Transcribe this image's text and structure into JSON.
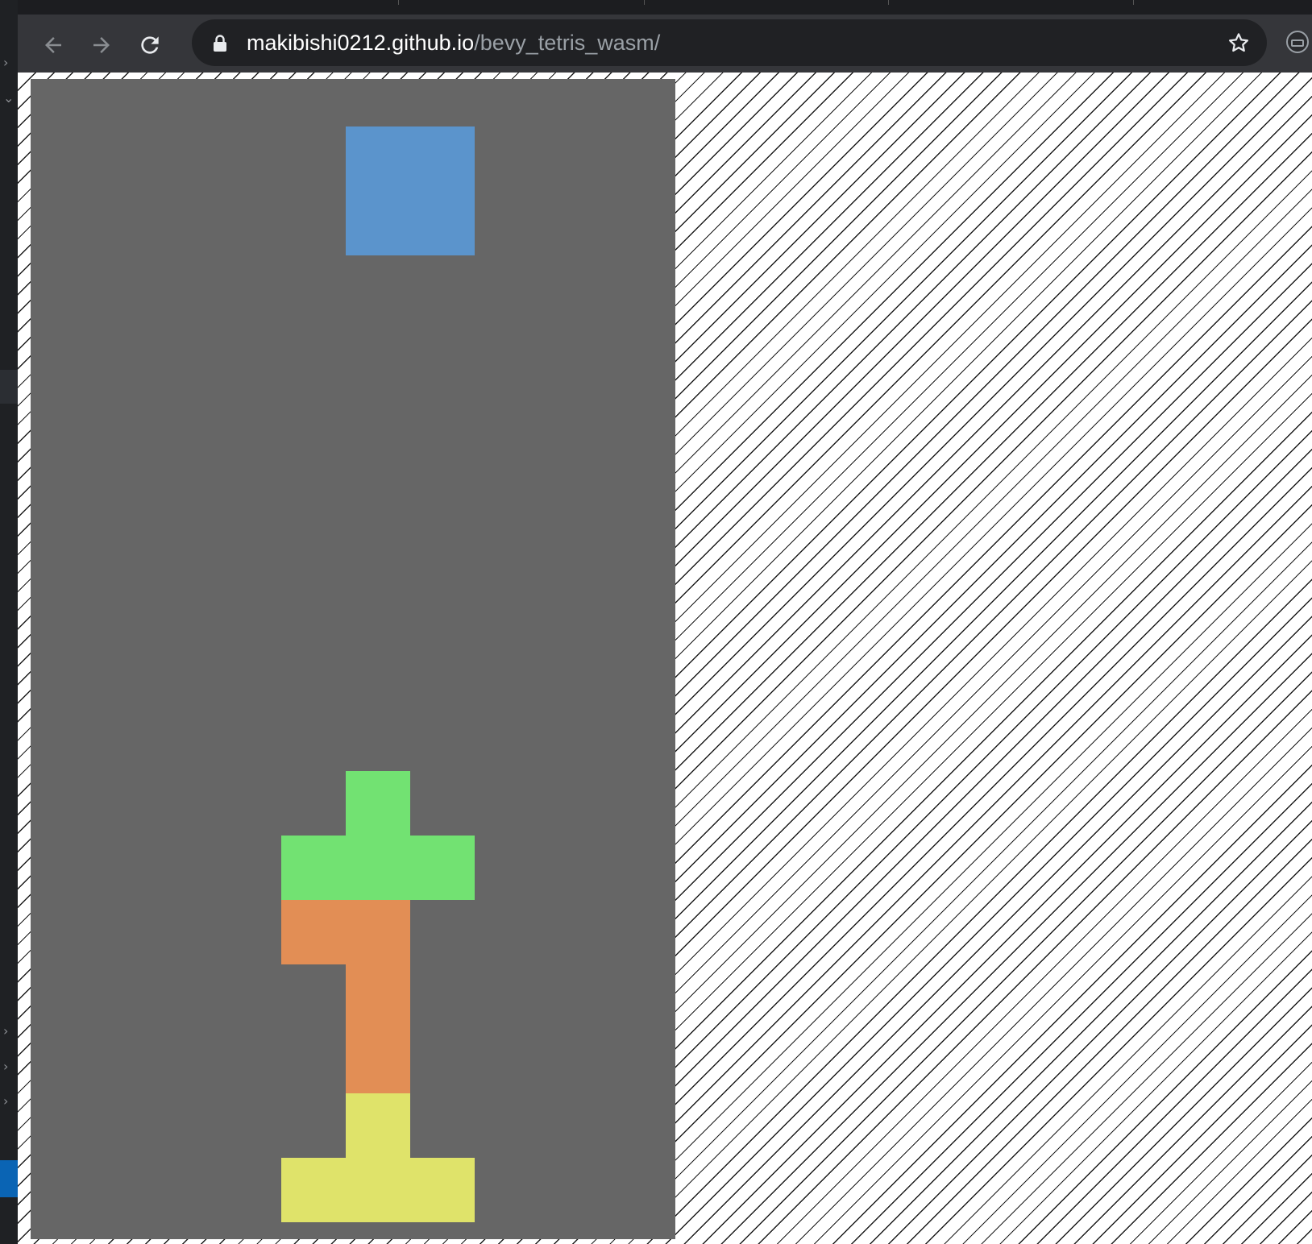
{
  "browser": {
    "url_host": "makibishi0212.github.io",
    "url_path": "/bevy_tetris_wasm/",
    "icons": {
      "back": "arrow-left-icon",
      "forward": "arrow-right-icon",
      "reload": "reload-icon",
      "lock": "lock-icon",
      "bookmark": "star-icon",
      "extension": "extension-icon"
    }
  },
  "game": {
    "board_columns": 10,
    "board_rows": 18,
    "colors": {
      "background": "#666666",
      "blue": "#5b94cc",
      "green": "#72e272",
      "orange": "#e28e55",
      "yellow": "#dfe36a"
    },
    "pieces": [
      {
        "name": "falling-o-piece",
        "color": "blue",
        "cells": [
          [
            5,
            1
          ],
          [
            6,
            1
          ],
          [
            5,
            2
          ],
          [
            6,
            2
          ]
        ]
      },
      {
        "name": "t-piece-top",
        "color": "green",
        "cells": [
          [
            5,
            11
          ],
          [
            4,
            12
          ],
          [
            5,
            12
          ],
          [
            6,
            12
          ]
        ]
      },
      {
        "name": "j-piece",
        "color": "orange",
        "cells": [
          [
            4,
            13
          ],
          [
            5,
            13
          ],
          [
            5,
            14
          ],
          [
            5,
            15
          ]
        ]
      },
      {
        "name": "t-piece-bottom",
        "color": "yellow",
        "cells": [
          [
            5,
            16
          ],
          [
            4,
            17
          ],
          [
            5,
            17
          ],
          [
            6,
            17
          ]
        ]
      }
    ]
  }
}
